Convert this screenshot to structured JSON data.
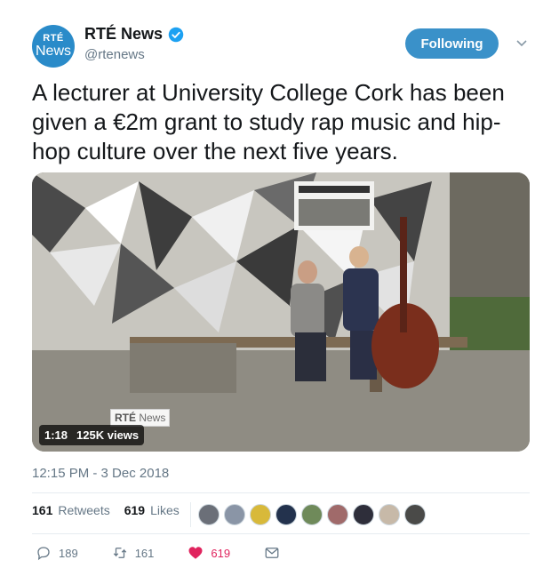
{
  "account": {
    "avatar_line1": "RTÉ",
    "avatar_line2": "News",
    "name": "RTÉ News",
    "handle": "@rtenews",
    "follow_label": "Following"
  },
  "tweet": {
    "text": "A lecturer at University College Cork has been given a €2m grant to study rap music and hip-hop culture over the next five years.",
    "timestamp": "12:15 PM - 3 Dec 2018"
  },
  "video": {
    "watermark_brand": "RTÉ",
    "watermark_word": "News",
    "duration": "1:18",
    "views": "125K views"
  },
  "engagement": {
    "retweets_count": "161",
    "retweets_label": "Retweets",
    "likes_count": "619",
    "likes_label": "Likes"
  },
  "likers": [
    {
      "icon": "liker-avatar",
      "color": "#6b6f78"
    },
    {
      "icon": "liker-avatar",
      "color": "#8a95a6"
    },
    {
      "icon": "liker-avatar",
      "color": "#d8b93a"
    },
    {
      "icon": "liker-avatar",
      "color": "#23324d"
    },
    {
      "icon": "liker-avatar",
      "color": "#6f8a5a"
    },
    {
      "icon": "liker-avatar",
      "color": "#a06a6a"
    },
    {
      "icon": "liker-avatar",
      "color": "#2e2e3a"
    },
    {
      "icon": "liker-avatar",
      "color": "#c7b9a8"
    },
    {
      "icon": "liker-avatar",
      "color": "#4a4a48"
    }
  ],
  "actions": {
    "reply_count": "189",
    "retweet_count": "161",
    "like_count": "619"
  },
  "colors": {
    "brand_blue": "#3a91c9",
    "like_red": "#e0245e",
    "muted_text": "#657786"
  }
}
